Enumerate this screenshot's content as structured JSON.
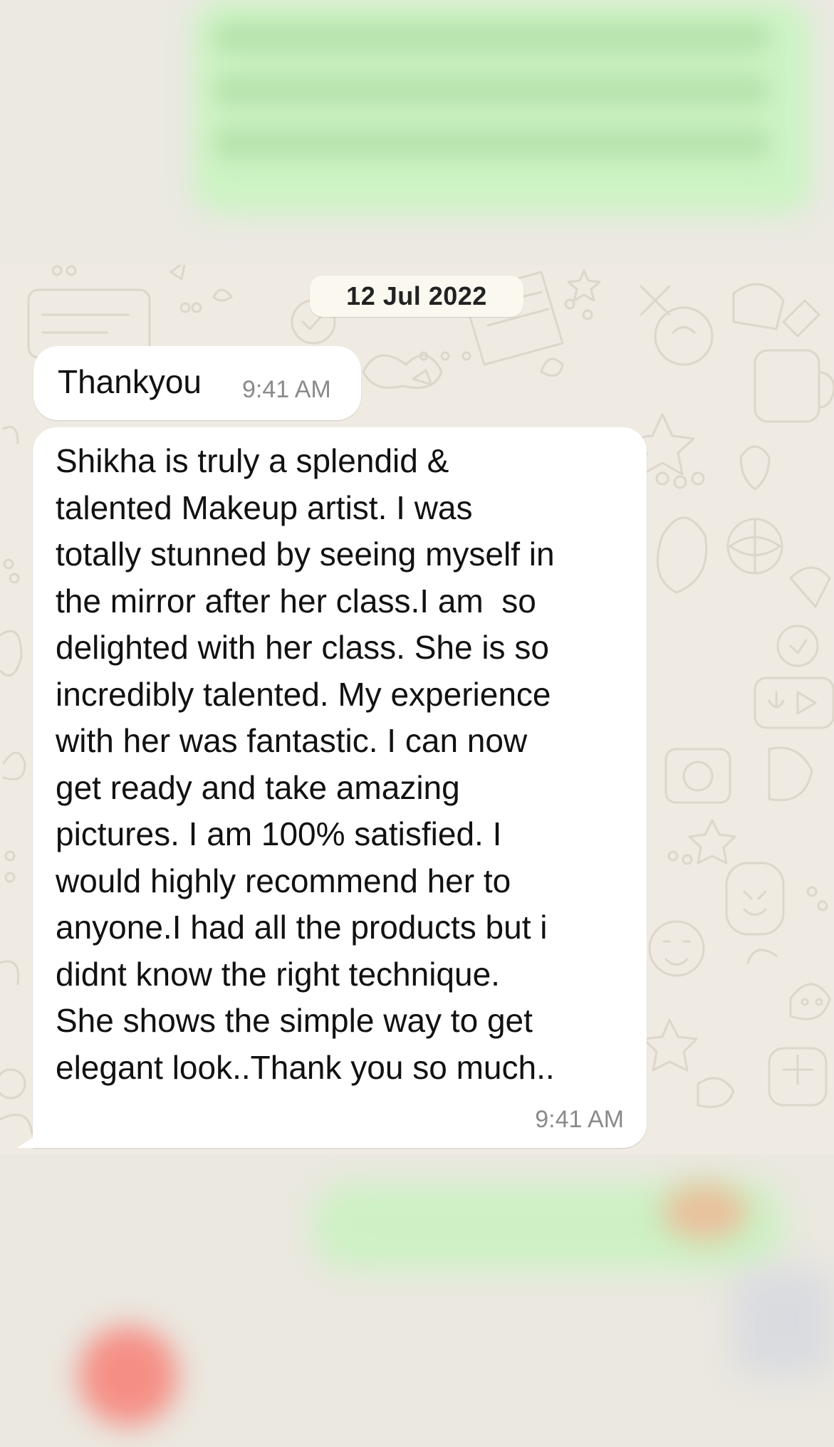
{
  "chat": {
    "date_chip": "12 Jul 2022",
    "messages": [
      {
        "text": "Thankyou",
        "time": "9:41 AM"
      },
      {
        "text": "Shikha is truly a splendid &\ntalented Makeup artist. I was\ntotally stunned by seeing myself in\nthe mirror after her class.I am  so\ndelighted with her class. She is so\nincredibly talented. My experience\nwith her was fantastic. I can now\nget ready and take amazing\npictures. I am 100% satisfied. I\nwould highly recommend her to\nanyone.I had all the products but i\ndidnt know the right technique.\nShe shows the simple way to get\nelegant look..Thank you so much..",
        "time": "9:41 AM"
      }
    ]
  },
  "colors": {
    "wallpaper": "#efeae2",
    "incoming_bubble": "#ffffff",
    "outgoing_bubble_blurred": "#cdf3c4",
    "timestamp": "#8a8a8a"
  }
}
